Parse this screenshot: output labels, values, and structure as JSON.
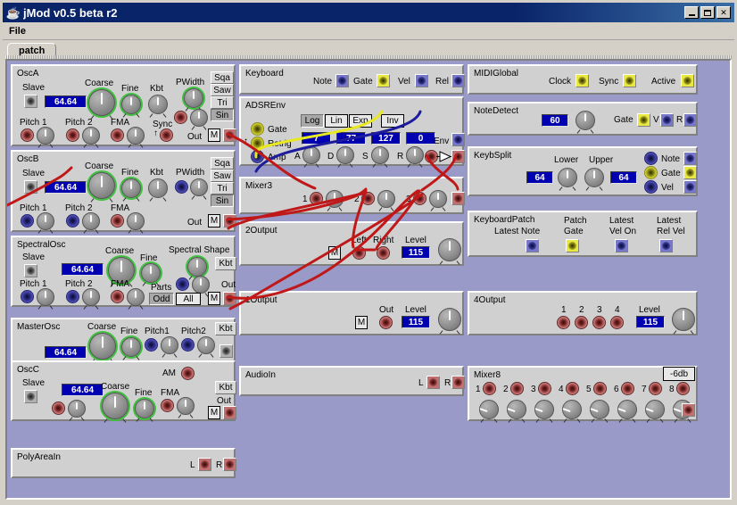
{
  "window": {
    "title": "jMod v0.5 beta r2",
    "logo_icon": "java-cup-icon",
    "buttons": {
      "minimize": "minimize-icon",
      "maximize": "maximize-icon",
      "close": "✕"
    }
  },
  "menu": {
    "items": [
      "File"
    ]
  },
  "tabs": [
    {
      "label": "patch",
      "active": true
    }
  ],
  "colors": {
    "desktop": "#d4d0c8",
    "titlebar": "#0a246a",
    "canvas": "#9a9ac8",
    "module": "#d0d0d0",
    "value_field_bg": "#0000b0",
    "cable_red": "#c01818",
    "cable_yellow": "#e8e820",
    "cable_blue": "#1c1c9c",
    "knob_ring": "#3fc040"
  },
  "modules": {
    "oscA": {
      "title": "OscA",
      "labels": {
        "slave": "Slave",
        "coarse": "Coarse",
        "fine": "Fine",
        "kbt": "Kbt",
        "pwidth": "PWidth",
        "pitch1": "Pitch 1",
        "pitch2": "Pitch 2",
        "fma": "FMA",
        "sync": "Sync",
        "out": "Out"
      },
      "value": "64.64",
      "waveforms": [
        {
          "label": "Sqa",
          "active": false
        },
        {
          "label": "Saw",
          "active": false
        },
        {
          "label": "Tri",
          "active": false
        },
        {
          "label": "Sin",
          "active": true
        }
      ],
      "mono_button": "M"
    },
    "oscB": {
      "title": "OscB",
      "labels": {
        "slave": "Slave",
        "coarse": "Coarse",
        "fine": "Fine",
        "kbt": "Kbt",
        "pwidth": "PWidth",
        "pitch1": "Pitch 1",
        "pitch2": "Pitch 2",
        "fma": "FMA",
        "out": "Out"
      },
      "value": "64.64",
      "waveforms": [
        {
          "label": "Sqa",
          "active": false
        },
        {
          "label": "Saw",
          "active": false
        },
        {
          "label": "Tri",
          "active": false
        },
        {
          "label": "Sin",
          "active": true
        }
      ],
      "mono_button": "M"
    },
    "spectralOsc": {
      "title": "SpectralOsc",
      "labels": {
        "slave": "Slave",
        "coarse": "Coarse",
        "fine": "Fine",
        "spectral_shape": "Spectral Shape",
        "pitch1": "Pitch 1",
        "pitch2": "Pitch 2",
        "fma": "FMA",
        "parts": "Parts",
        "out": "Out"
      },
      "value": "64.64",
      "kbt_button": "Kbt",
      "parts_buttons": [
        {
          "label": "Odd",
          "active": true
        },
        {
          "label": "All",
          "active": false
        }
      ],
      "mono_button": "M"
    },
    "masterOsc": {
      "title": "MasterOsc",
      "labels": {
        "coarse": "Coarse",
        "fine": "Fine",
        "pitch1": "Pitch1",
        "pitch2": "Pitch2"
      },
      "value": "64.64",
      "kbt_button": "Kbt"
    },
    "oscC": {
      "title": "OscC",
      "labels": {
        "slave": "Slave",
        "coarse": "Coarse",
        "fine": "Fine",
        "am": "AM",
        "fma": "FMA",
        "out": "Out"
      },
      "value": "64.64",
      "kbt_button": "Kbt",
      "mono_button": "M"
    },
    "polyAreaIn": {
      "title": "PolyAreaIn",
      "labels": {
        "left": "L",
        "right": "R"
      }
    },
    "keyboard": {
      "title": "Keyboard",
      "ports": [
        {
          "label": "Note",
          "color": "blue"
        },
        {
          "label": "Gate",
          "color": "yellow"
        },
        {
          "label": "Vel",
          "color": "blue"
        },
        {
          "label": "Rel",
          "color": "blue"
        }
      ]
    },
    "adsrEnv": {
      "title": "ADSREnv",
      "curve_buttons": [
        {
          "label": "Log",
          "active": true
        },
        {
          "label": "Lin",
          "active": false
        },
        {
          "label": "Exp",
          "active": false
        }
      ],
      "inv_button": "Inv",
      "inputs": [
        {
          "label": "Gate",
          "color": "yellow"
        },
        {
          "label": "Retrig",
          "color": "yellow"
        },
        {
          "label": "Amp",
          "color": "blue"
        }
      ],
      "stages": [
        {
          "label": "A",
          "value": "7"
        },
        {
          "label": "D",
          "value": "77"
        },
        {
          "label": "S",
          "value": "127"
        },
        {
          "label": "R",
          "value": "0"
        }
      ],
      "env_label": "Env"
    },
    "mixer3": {
      "title": "Mixer3",
      "channels": [
        "1",
        "2",
        "3"
      ]
    },
    "output2": {
      "title": "2Output",
      "labels": {
        "left": "Left",
        "right": "Right",
        "level": "Level"
      },
      "mono_button": "M",
      "level": "115"
    },
    "output1": {
      "title": "1Output",
      "labels": {
        "out": "Out",
        "level": "Level"
      },
      "mono_button": "M",
      "level": "115"
    },
    "audioIn": {
      "title": "AudioIn",
      "labels": {
        "left": "L",
        "right": "R"
      }
    },
    "midiGlobal": {
      "title": "MIDIGlobal",
      "ports": [
        {
          "label": "Clock",
          "color": "yellow"
        },
        {
          "label": "Sync",
          "color": "yellow"
        },
        {
          "label": "Active",
          "color": "yellow"
        }
      ]
    },
    "noteDetect": {
      "title": "NoteDetect",
      "value": "60",
      "ports": [
        {
          "label": "Gate",
          "color": "yellow"
        },
        {
          "label": "V",
          "color": "blue"
        },
        {
          "label": "R",
          "color": "blue"
        }
      ]
    },
    "keybSplit": {
      "title": "KeybSplit",
      "labels": {
        "lower": "Lower",
        "upper": "Upper"
      },
      "lower_value": "64",
      "upper_value": "64",
      "ports": [
        {
          "label": "Note",
          "color": "blue"
        },
        {
          "label": "Gate",
          "color": "yellow"
        },
        {
          "label": "Vel",
          "color": "blue"
        }
      ]
    },
    "keyboardPatch": {
      "title": "KeyboardPatch",
      "columns": [
        {
          "line1": "Latest Note",
          "line2": "",
          "color": "blue"
        },
        {
          "line1": "Patch",
          "line2": "Gate",
          "color": "yellow"
        },
        {
          "line1": "Latest",
          "line2": "Vel On",
          "color": "blue"
        },
        {
          "line1": "Latest",
          "line2": "Rel Vel",
          "color": "blue"
        }
      ]
    },
    "output4": {
      "title": "4Output",
      "channels": [
        "1",
        "2",
        "3",
        "4"
      ],
      "level_label": "Level",
      "level": "115"
    },
    "mixer8": {
      "title": "Mixer8",
      "channels": [
        "1",
        "2",
        "3",
        "4",
        "5",
        "6",
        "7",
        "8"
      ],
      "db_button": "-6db"
    }
  }
}
